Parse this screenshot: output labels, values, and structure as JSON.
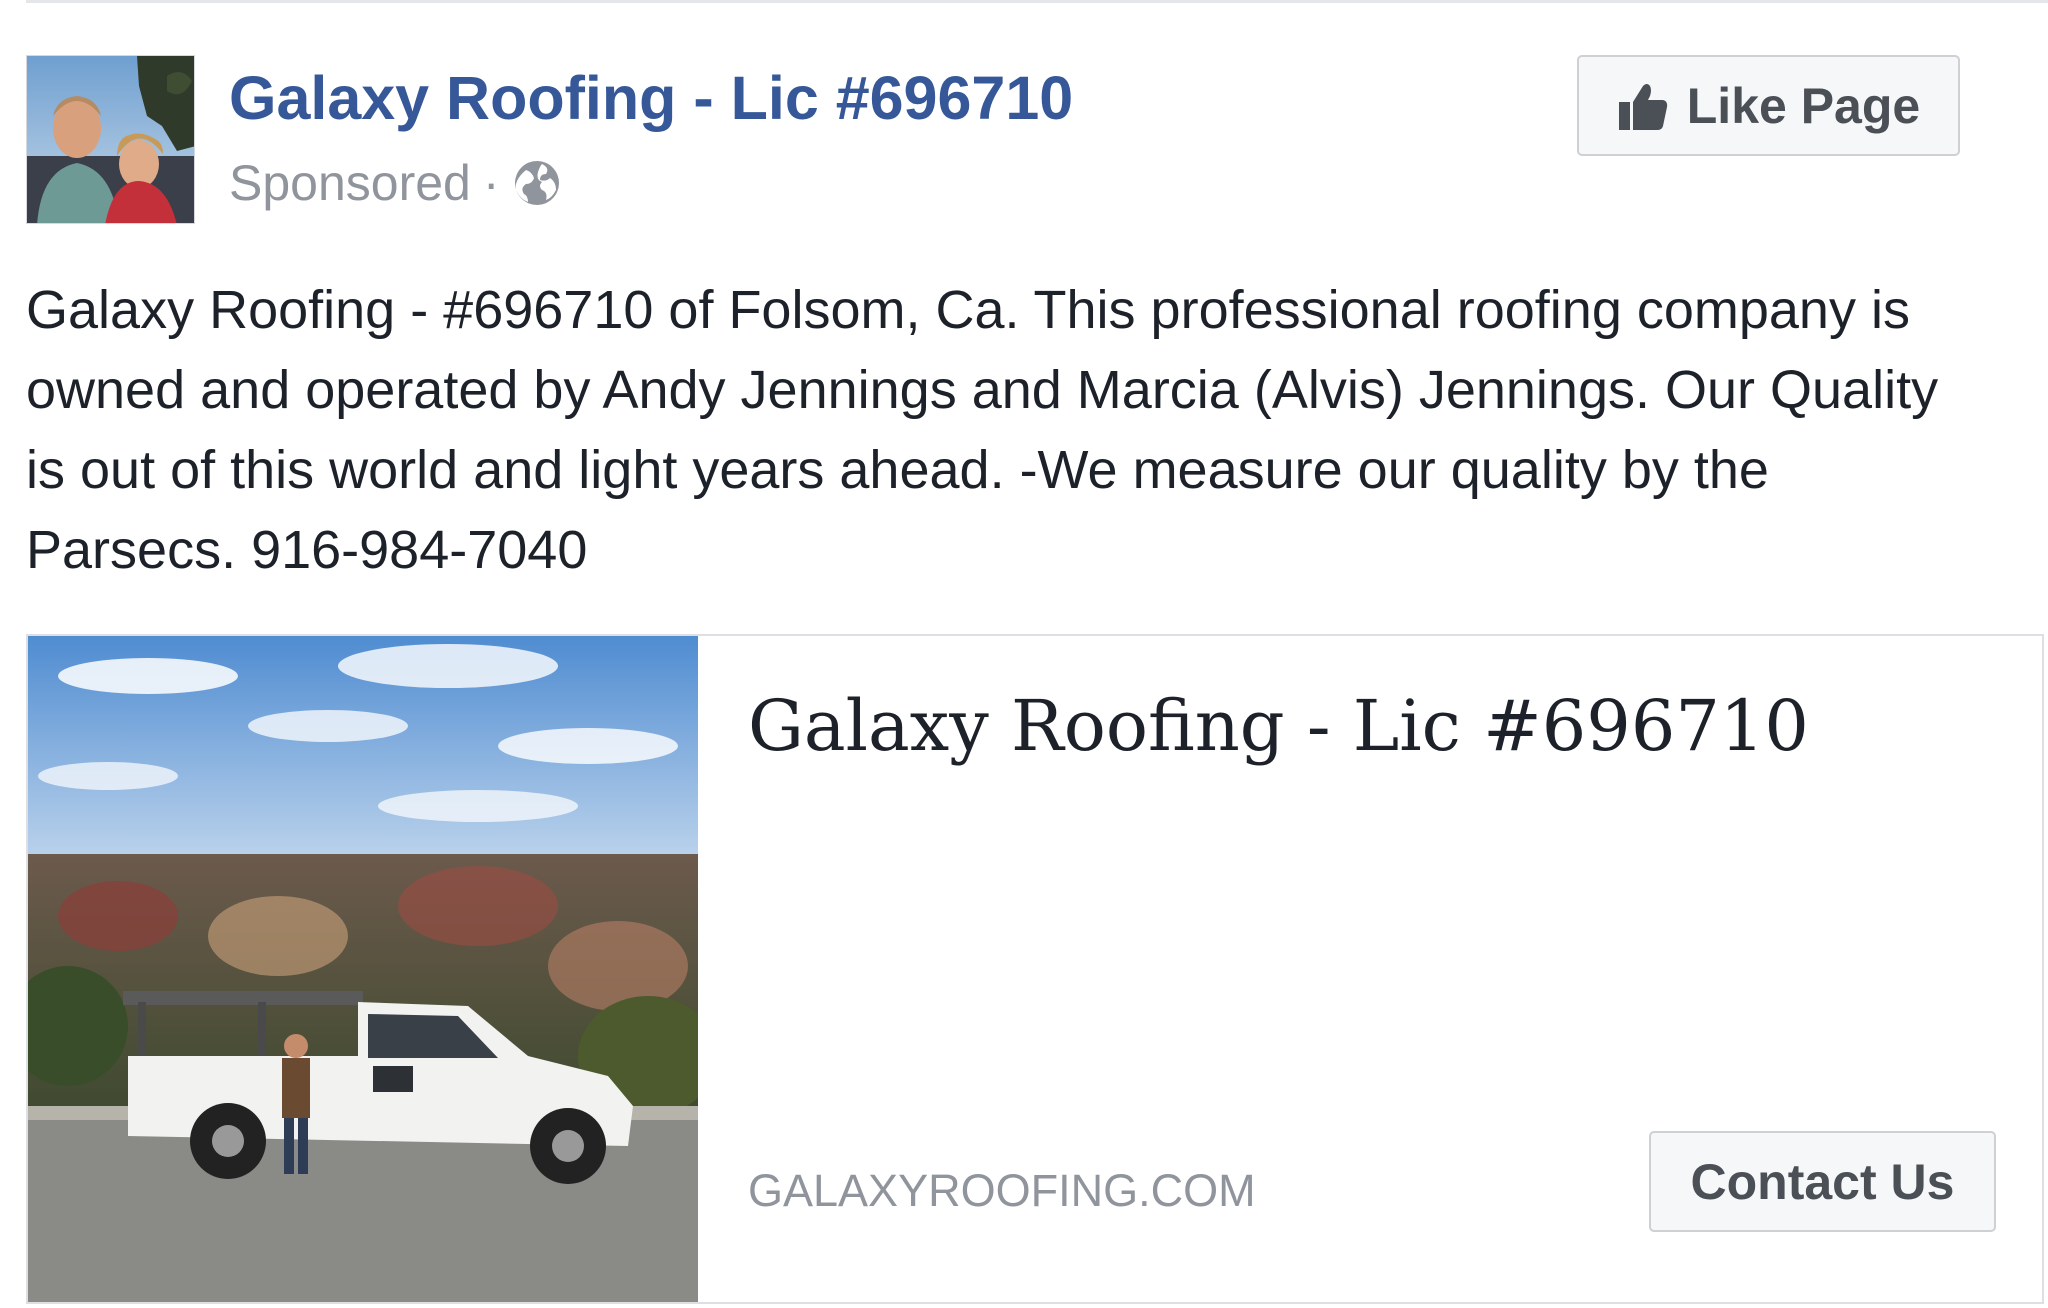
{
  "post": {
    "page_name": "Galaxy Roofing - Lic #696710",
    "sponsored_label": "Sponsored",
    "separator": "·",
    "like_button_label": "Like Page",
    "body_text": "Galaxy Roofing - #696710 of Folsom, Ca. This professional roofing company is owned and operated by Andy Jennings and Marcia (Alvis) Jennings. Our Quality is out of this world and light years ahead. -We measure our quality by the Parsecs. 916-984-7040"
  },
  "link_card": {
    "title": "Galaxy Roofing - Lic #696710",
    "domain": "GALAXYROOFING.COM",
    "cta_label": "Contact Us"
  },
  "colors": {
    "link_blue": "#365899",
    "secondary_text": "#90949c",
    "primary_text": "#1d2129",
    "button_text": "#4b4f56",
    "button_bg": "#f6f7f9",
    "border": "#dddfe2"
  },
  "icons": {
    "audience": "globe-icon",
    "like": "thumbs-up-icon"
  }
}
